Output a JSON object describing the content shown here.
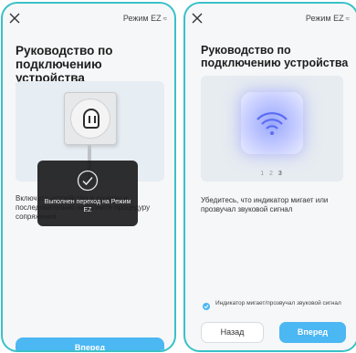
{
  "colors": {
    "accent": "#4bb7f3",
    "frame": "#39c1c8",
    "overlay_bg": "#1c1c1e"
  },
  "left_screen": {
    "mode_label": "Режим EZ",
    "title": "Руководство по подключению устройства",
    "instruction": "Включите устройство в розетку и последовательно наполните процедуру сопряжения",
    "overlay": {
      "message": "Выполнен переход на Режим EZ"
    },
    "next_button": "Вперед"
  },
  "right_screen": {
    "mode_label": "Режим EZ",
    "title": "Руководство по подключению устройства",
    "pager": {
      "items": [
        "1",
        "2",
        "3"
      ],
      "current_index": 2
    },
    "instruction": "Убедитесь, что индикатор мигает или прозвучал звуковой сигнал",
    "checkbox": {
      "label": "Индикатор мигает/прозвучал звуковой сигнал",
      "checked": true
    },
    "back_button": "Назад",
    "next_button": "Вперед"
  }
}
